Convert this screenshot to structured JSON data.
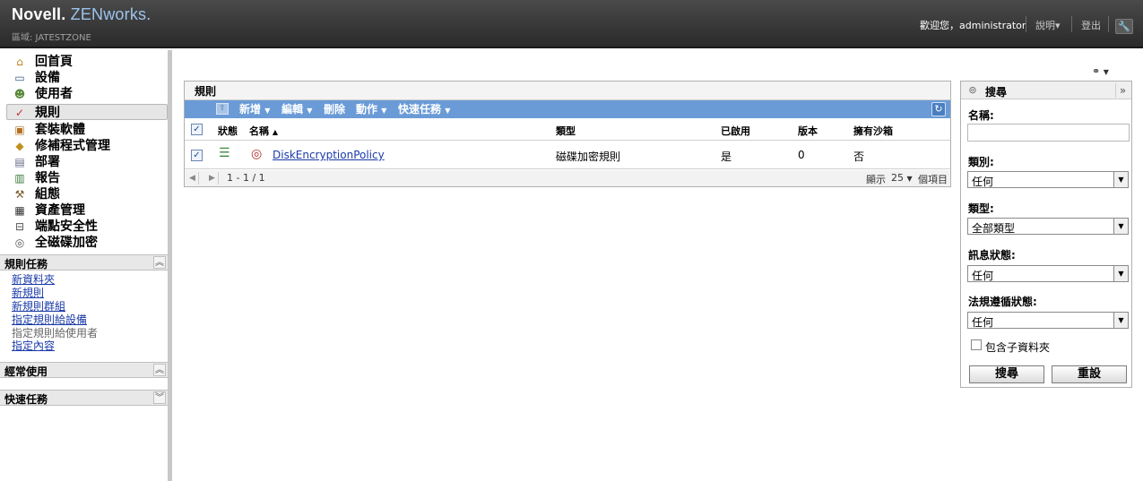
{
  "header": {
    "brand_novell": "Novell.",
    "brand_product": "ZENworks.",
    "zone": "區域: JATESTZONE",
    "welcome": "歡迎您，administrator",
    "help": "說明▾",
    "logout": "登出",
    "tools_icon": "wrench-icon"
  },
  "nav": {
    "items": [
      {
        "label": "回首頁",
        "icon": "home-icon"
      },
      {
        "label": "設備",
        "icon": "monitor-icon"
      },
      {
        "label": "使用者",
        "icon": "users-icon"
      },
      {
        "label": "規則",
        "icon": "policy-icon"
      },
      {
        "label": "套裝軟體",
        "icon": "bundle-icon"
      },
      {
        "label": "修補程式管理",
        "icon": "shield-icon"
      },
      {
        "label": "部署",
        "icon": "deploy-icon"
      },
      {
        "label": "報告",
        "icon": "report-icon"
      },
      {
        "label": "組態",
        "icon": "wrench-icon"
      },
      {
        "label": "資產管理",
        "icon": "asset-icon"
      },
      {
        "label": "端點安全性",
        "icon": "lock-icon"
      },
      {
        "label": "全磁碟加密",
        "icon": "disk-icon"
      }
    ],
    "selected": "規則"
  },
  "tasks": {
    "title": "規則任務",
    "links": [
      {
        "label": "新資料夾",
        "enabled": true
      },
      {
        "label": "新規則",
        "enabled": true
      },
      {
        "label": "新規則群組",
        "enabled": true
      },
      {
        "label": "指定規則給設備",
        "enabled": true
      },
      {
        "label": "指定規則給使用者",
        "enabled": false
      },
      {
        "label": "指定內容",
        "enabled": true
      }
    ]
  },
  "frequent": {
    "title": "經常使用"
  },
  "quicktasks": {
    "title": "快速任務"
  },
  "rules": {
    "title": "規則",
    "toolbar": {
      "new": "新增",
      "edit": "編輯",
      "delete": "刪除",
      "action": "動作",
      "quick": "快速任務"
    },
    "columns": {
      "status": "狀態",
      "name": "名稱",
      "type": "類型",
      "enabled": "已啟用",
      "version": "版本",
      "sandbox": "擁有沙箱"
    },
    "rows": [
      {
        "name": "DiskEncryptionPolicy",
        "type": "磁碟加密規則",
        "enabled": "是",
        "version": "0",
        "sandbox": "否"
      }
    ],
    "pager": {
      "range": "1 - 1 / 1",
      "show": "顯示",
      "per_page": "25",
      "items": "個項目"
    }
  },
  "search": {
    "title": "搜尋",
    "name_label": "名稱:",
    "name_value": "",
    "category_label": "類別:",
    "category_value": "任何",
    "type_label": "類型:",
    "type_value": "全部類型",
    "message_label": "訊息狀態:",
    "message_value": "任何",
    "compliance_label": "法規遵循狀態:",
    "compliance_value": "任何",
    "subfolders_label": "包含子資料夾",
    "search_button": "搜尋",
    "reset_button": "重設"
  }
}
